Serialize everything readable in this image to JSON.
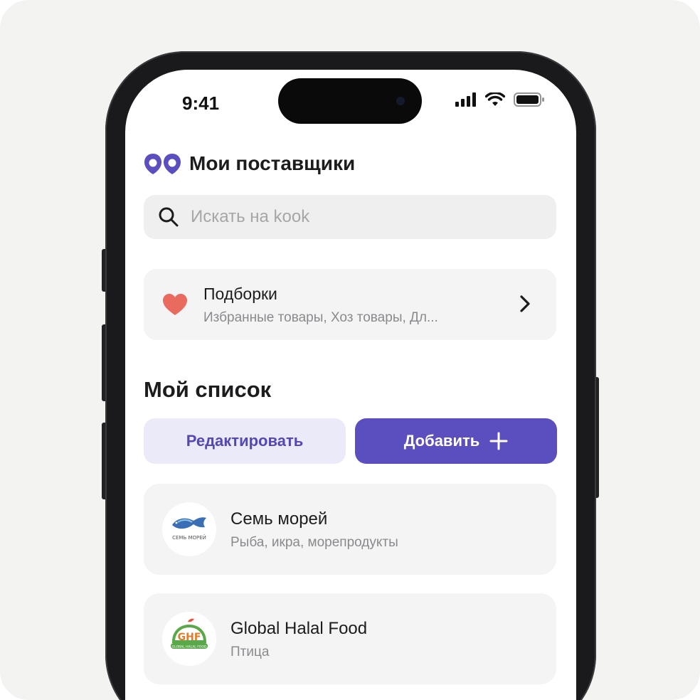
{
  "status_bar": {
    "time": "9:41"
  },
  "header": {
    "title": "Мои поставщики",
    "logo_icon": "kook-logo-icon"
  },
  "search": {
    "placeholder": "Искать на kook",
    "icon": "search-icon"
  },
  "collections": {
    "title": "Подборки",
    "subtitle": "Избранные товары, Хоз товары, Дл...",
    "icon": "heart-icon"
  },
  "my_list": {
    "title": "Мой список",
    "edit_label": "Редактировать",
    "add_label": "Добавить"
  },
  "suppliers": [
    {
      "name": "Семь морей",
      "description": "Рыба, икра, морепродукты",
      "logo_text": "СЕМЬ МОРЕЙ"
    },
    {
      "name": "Global Halal Food",
      "description": "Птица",
      "logo_text": "GLOBAL HALAL FOOD"
    }
  ],
  "colors": {
    "accent": "#5b4ebf",
    "accent_light": "#ebeaf8",
    "heart": "#e96a5f",
    "card_bg": "#f4f4f4"
  }
}
